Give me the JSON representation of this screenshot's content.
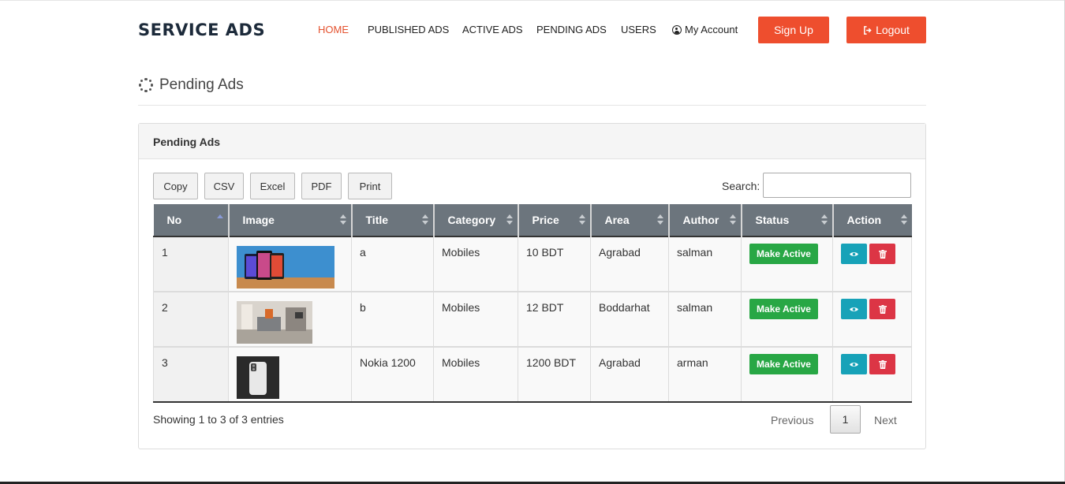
{
  "brand": "SERVICE ADS",
  "nav": {
    "home": "HOME",
    "published": "PUBLISHED ADS",
    "active": "ACTIVE ADS",
    "pending": "PENDING ADS",
    "users": "USERS",
    "account": "My Account",
    "signup": "Sign Up",
    "logout": "Logout"
  },
  "page_title": "Pending Ads",
  "panel_title": "Pending Ads",
  "export_buttons": [
    "Copy",
    "CSV",
    "Excel",
    "PDF",
    "Print"
  ],
  "search": {
    "label": "Search:",
    "value": ""
  },
  "table": {
    "columns": [
      "No",
      "Image",
      "Title",
      "Category",
      "Price",
      "Area",
      "Author",
      "Status",
      "Action"
    ],
    "rows": [
      {
        "no": "1",
        "title": "a",
        "category": "Mobiles",
        "price": "10 BDT",
        "area": "Agrabad",
        "author": "salman",
        "status_action": "Make Active"
      },
      {
        "no": "2",
        "title": "b",
        "category": "Mobiles",
        "price": "12 BDT",
        "area": "Boddarhat",
        "author": "salman",
        "status_action": "Make Active"
      },
      {
        "no": "3",
        "title": "Nokia 1200",
        "category": "Mobiles",
        "price": "1200 BDT",
        "area": "Agrabad",
        "author": "arman",
        "status_action": "Make Active"
      }
    ]
  },
  "footer": {
    "showing": "Showing 1 to 3 of 3 entries",
    "previous": "Previous",
    "current_page": "1",
    "next": "Next"
  },
  "colors": {
    "brand_accent": "#ee4e2e",
    "table_header": "#6c757d",
    "make_active": "#28a745",
    "view": "#17a2b8",
    "delete": "#dc3545"
  },
  "icons": {
    "page_title": "spinner-icon",
    "account": "user-circle-icon",
    "logout": "sign-out-icon",
    "view": "eye-icon",
    "delete": "trash-icon"
  }
}
